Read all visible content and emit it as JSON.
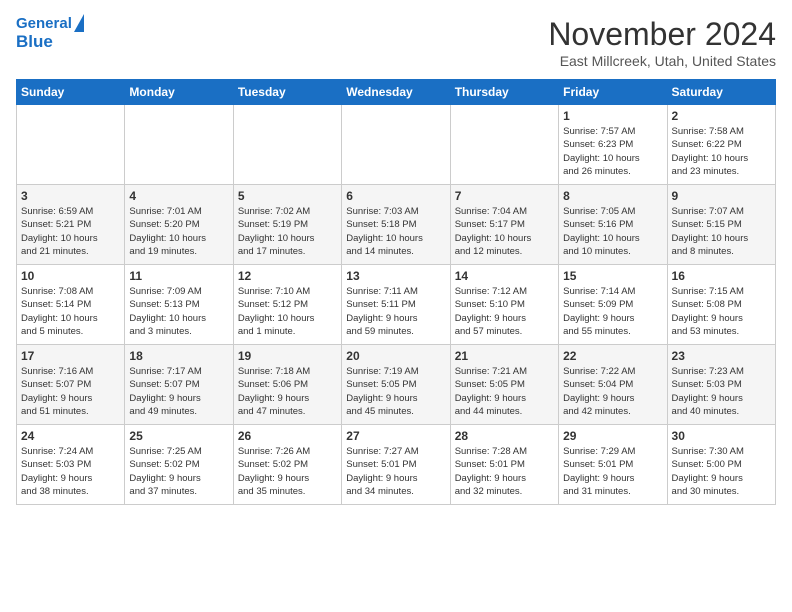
{
  "header": {
    "logo_line1": "General",
    "logo_line2": "Blue",
    "month": "November 2024",
    "location": "East Millcreek, Utah, United States"
  },
  "calendar": {
    "days_of_week": [
      "Sunday",
      "Monday",
      "Tuesday",
      "Wednesday",
      "Thursday",
      "Friday",
      "Saturday"
    ],
    "weeks": [
      [
        {
          "day": "",
          "info": ""
        },
        {
          "day": "",
          "info": ""
        },
        {
          "day": "",
          "info": ""
        },
        {
          "day": "",
          "info": ""
        },
        {
          "day": "",
          "info": ""
        },
        {
          "day": "1",
          "info": "Sunrise: 7:57 AM\nSunset: 6:23 PM\nDaylight: 10 hours\nand 26 minutes."
        },
        {
          "day": "2",
          "info": "Sunrise: 7:58 AM\nSunset: 6:22 PM\nDaylight: 10 hours\nand 23 minutes."
        }
      ],
      [
        {
          "day": "3",
          "info": "Sunrise: 6:59 AM\nSunset: 5:21 PM\nDaylight: 10 hours\nand 21 minutes."
        },
        {
          "day": "4",
          "info": "Sunrise: 7:01 AM\nSunset: 5:20 PM\nDaylight: 10 hours\nand 19 minutes."
        },
        {
          "day": "5",
          "info": "Sunrise: 7:02 AM\nSunset: 5:19 PM\nDaylight: 10 hours\nand 17 minutes."
        },
        {
          "day": "6",
          "info": "Sunrise: 7:03 AM\nSunset: 5:18 PM\nDaylight: 10 hours\nand 14 minutes."
        },
        {
          "day": "7",
          "info": "Sunrise: 7:04 AM\nSunset: 5:17 PM\nDaylight: 10 hours\nand 12 minutes."
        },
        {
          "day": "8",
          "info": "Sunrise: 7:05 AM\nSunset: 5:16 PM\nDaylight: 10 hours\nand 10 minutes."
        },
        {
          "day": "9",
          "info": "Sunrise: 7:07 AM\nSunset: 5:15 PM\nDaylight: 10 hours\nand 8 minutes."
        }
      ],
      [
        {
          "day": "10",
          "info": "Sunrise: 7:08 AM\nSunset: 5:14 PM\nDaylight: 10 hours\nand 5 minutes."
        },
        {
          "day": "11",
          "info": "Sunrise: 7:09 AM\nSunset: 5:13 PM\nDaylight: 10 hours\nand 3 minutes."
        },
        {
          "day": "12",
          "info": "Sunrise: 7:10 AM\nSunset: 5:12 PM\nDaylight: 10 hours\nand 1 minute."
        },
        {
          "day": "13",
          "info": "Sunrise: 7:11 AM\nSunset: 5:11 PM\nDaylight: 9 hours\nand 59 minutes."
        },
        {
          "day": "14",
          "info": "Sunrise: 7:12 AM\nSunset: 5:10 PM\nDaylight: 9 hours\nand 57 minutes."
        },
        {
          "day": "15",
          "info": "Sunrise: 7:14 AM\nSunset: 5:09 PM\nDaylight: 9 hours\nand 55 minutes."
        },
        {
          "day": "16",
          "info": "Sunrise: 7:15 AM\nSunset: 5:08 PM\nDaylight: 9 hours\nand 53 minutes."
        }
      ],
      [
        {
          "day": "17",
          "info": "Sunrise: 7:16 AM\nSunset: 5:07 PM\nDaylight: 9 hours\nand 51 minutes."
        },
        {
          "day": "18",
          "info": "Sunrise: 7:17 AM\nSunset: 5:07 PM\nDaylight: 9 hours\nand 49 minutes."
        },
        {
          "day": "19",
          "info": "Sunrise: 7:18 AM\nSunset: 5:06 PM\nDaylight: 9 hours\nand 47 minutes."
        },
        {
          "day": "20",
          "info": "Sunrise: 7:19 AM\nSunset: 5:05 PM\nDaylight: 9 hours\nand 45 minutes."
        },
        {
          "day": "21",
          "info": "Sunrise: 7:21 AM\nSunset: 5:05 PM\nDaylight: 9 hours\nand 44 minutes."
        },
        {
          "day": "22",
          "info": "Sunrise: 7:22 AM\nSunset: 5:04 PM\nDaylight: 9 hours\nand 42 minutes."
        },
        {
          "day": "23",
          "info": "Sunrise: 7:23 AM\nSunset: 5:03 PM\nDaylight: 9 hours\nand 40 minutes."
        }
      ],
      [
        {
          "day": "24",
          "info": "Sunrise: 7:24 AM\nSunset: 5:03 PM\nDaylight: 9 hours\nand 38 minutes."
        },
        {
          "day": "25",
          "info": "Sunrise: 7:25 AM\nSunset: 5:02 PM\nDaylight: 9 hours\nand 37 minutes."
        },
        {
          "day": "26",
          "info": "Sunrise: 7:26 AM\nSunset: 5:02 PM\nDaylight: 9 hours\nand 35 minutes."
        },
        {
          "day": "27",
          "info": "Sunrise: 7:27 AM\nSunset: 5:01 PM\nDaylight: 9 hours\nand 34 minutes."
        },
        {
          "day": "28",
          "info": "Sunrise: 7:28 AM\nSunset: 5:01 PM\nDaylight: 9 hours\nand 32 minutes."
        },
        {
          "day": "29",
          "info": "Sunrise: 7:29 AM\nSunset: 5:01 PM\nDaylight: 9 hours\nand 31 minutes."
        },
        {
          "day": "30",
          "info": "Sunrise: 7:30 AM\nSunset: 5:00 PM\nDaylight: 9 hours\nand 30 minutes."
        }
      ]
    ]
  }
}
